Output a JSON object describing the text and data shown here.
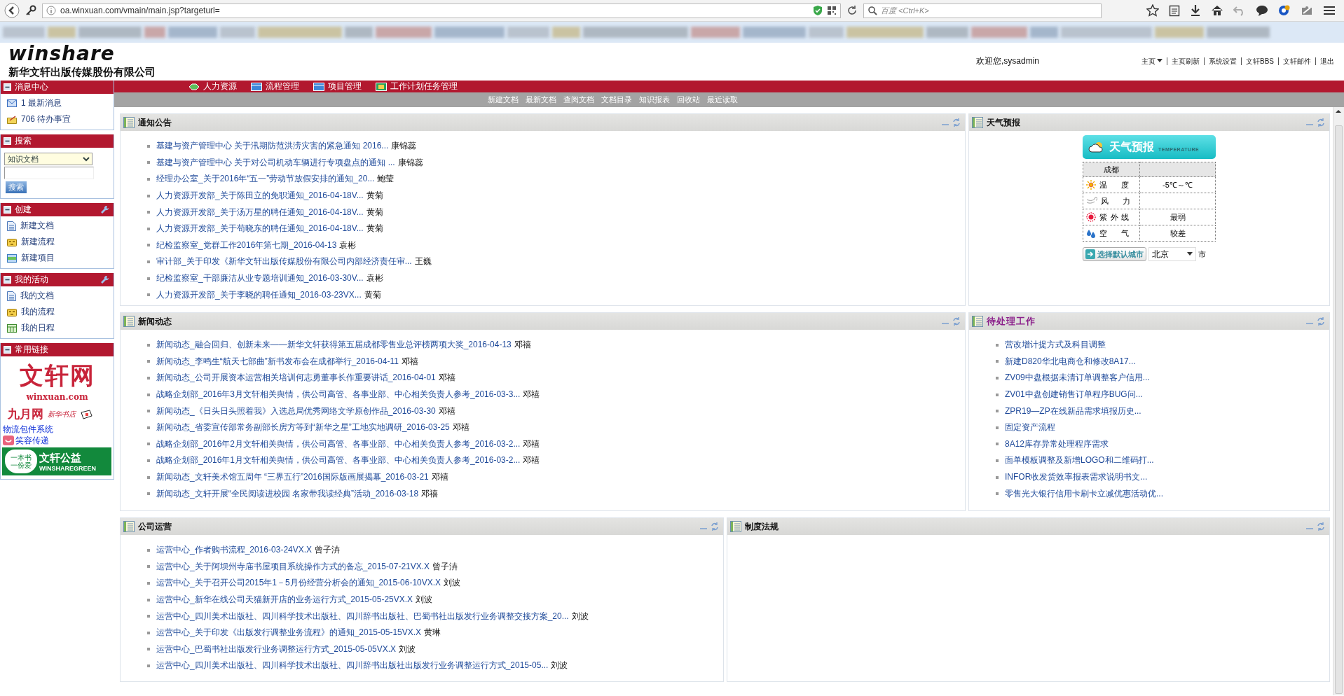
{
  "browser": {
    "url": "oa.winxuan.com/vmain/main.jsp?targeturl=",
    "search_placeholder": "百度 <Ctrl+K>"
  },
  "header": {
    "logo": "winshare",
    "company": "新华文轩出版传媒股份有限公司",
    "welcome": "欢迎您,sysadmin",
    "links": [
      "主页",
      "主页刷新",
      "系统设置",
      "文轩BBS",
      "文轩邮件",
      "退出"
    ]
  },
  "nav": {
    "tabs": [
      {
        "label": "人力资源",
        "selected": false
      },
      {
        "label": "流程管理",
        "selected": false
      },
      {
        "label": "项目管理",
        "selected": false
      },
      {
        "label": "工作计划任务管理",
        "selected": false
      }
    ],
    "subnav": [
      "新建文档",
      "最新文档",
      "查阅文档",
      "文档目录",
      "知识报表",
      "回收站",
      "最近读取"
    ]
  },
  "sidebar": [
    {
      "kind": "messages",
      "title": "消息中心",
      "tool": false,
      "items": [
        "1 最新消息",
        "706 待办事宜"
      ]
    },
    {
      "kind": "search",
      "title": "搜索",
      "tool": false,
      "select": "知识文档",
      "button": "搜索"
    },
    {
      "kind": "list",
      "title": "创建",
      "tool": true,
      "items": [
        "新建文档",
        "新建流程",
        "新建项目"
      ]
    },
    {
      "kind": "list",
      "title": "我的活动",
      "tool": true,
      "items": [
        "我的文档",
        "我的流程",
        "我的日程"
      ]
    },
    {
      "kind": "links",
      "title": "常用链接",
      "tool": false,
      "logo_1": {
        "name": "文轩网",
        "domain": "winxuan.com"
      },
      "logo_2": {
        "name": "九月网",
        "tag": "新华书店"
      },
      "links": [
        "物流包件系统",
        "笑容传递"
      ],
      "banner": {
        "slogan_1": "一本书",
        "slogan_2": "一份爱",
        "name": "文轩公益",
        "english": "WINSHAREGREEN"
      }
    }
  ],
  "rows": [
    [
      {
        "kind": "list",
        "title": "通知公告",
        "accent": false,
        "items": [
          {
            "title": "基建与资产管理中心 关于汛期防范洪涝灾害的紧急通知 2016...",
            "author": "康锦蕊"
          },
          {
            "title": "基建与资产管理中心 关于对公司机动车辆进行专项盘点的通知 ...",
            "author": "康锦蕊"
          },
          {
            "title": "经理办公室_关于2016年“五一”劳动节放假安排的通知_20...",
            "author": "鲍莹"
          },
          {
            "title": "人力资源开发部_关于陈田立的免职通知_2016-04-18V...",
            "author": "黄菊"
          },
          {
            "title": "人力资源开发部_关于汤万星的聘任通知_2016-04-18V...",
            "author": "黄菊"
          },
          {
            "title": "人力资源开发部_关于苟晓东的聘任通知_2016-04-18V...",
            "author": "黄菊"
          },
          {
            "title": "纪检监察室_党群工作2016年第七期_2016-04-13",
            "author": "袁彬"
          },
          {
            "title": "审计部_关于印发《新华文轩出版传媒股份有限公司内部经济责任审...",
            "author": "王巍"
          },
          {
            "title": "纪检监察室_干部廉洁从业专题培训通知_2016-03-30V...",
            "author": "袁彬"
          },
          {
            "title": "人力资源开发部_关于李晓的聘任通知_2016-03-23VX...",
            "author": "黄菊"
          }
        ]
      },
      {
        "kind": "weather",
        "title": "天气预报",
        "accent": false,
        "banner": "天气预报",
        "banner_sub": "TEMPERATURE",
        "city": "成都",
        "rows": [
          {
            "label": "温 度",
            "value": "-5℃～℃"
          },
          {
            "label": "风 力"
          },
          {
            "label": "紫外线",
            "value": "最弱"
          },
          {
            "label": "空 气",
            "value": "较差"
          }
        ],
        "button": "选择默认城市",
        "city_select": "北京",
        "suffix": "市"
      }
    ],
    [
      {
        "kind": "list",
        "title": "新闻动态",
        "accent": false,
        "items": [
          {
            "title": "新闻动态_融合回归、创新未来——新华文轩获得第五届成都零售业总评榜两项大奖_2016-04-13",
            "author": "邓禧"
          },
          {
            "title": "新闻动态_李鸣生“航天七部曲”新书发布会在成都举行_2016-04-11",
            "author": "邓禧"
          },
          {
            "title": "新闻动态_公司开展资本运营相关培训何志勇董事长作重要讲话_2016-04-01",
            "author": "邓禧"
          },
          {
            "title": "战略企划部_2016年3月文轩相关舆情，供公司高管、各事业部、中心相关负责人参考_2016-03-3...",
            "author": "邓禧"
          },
          {
            "title": "新闻动态_《日头日头照着我》入选总局优秀网络文学原创作品_2016-03-30",
            "author": "邓禧"
          },
          {
            "title": "新闻动态_省委宣传部常务副部长房方等到“新华之星”工地实地调研_2016-03-25",
            "author": "邓禧"
          },
          {
            "title": "战略企划部_2016年2月文轩相关舆情，供公司高管、各事业部、中心相关负责人参考_2016-03-2...",
            "author": "邓禧"
          },
          {
            "title": "战略企划部_2016年1月文轩相关舆情，供公司高管、各事业部、中心相关负责人参考_2016-03-2...",
            "author": "邓禧"
          },
          {
            "title": "新闻动态_文轩美术馆五周年 “三界五行”2016国际版画展揭幕_2016-03-21",
            "author": "邓禧"
          },
          {
            "title": "新闻动态_文轩开展“全民阅读进校园 名家带我读经典”活动_2016-03-18",
            "author": "邓禧"
          }
        ]
      },
      {
        "kind": "list",
        "title": "待处理工作",
        "accent": true,
        "items": [
          {
            "title": "营改增计提方式及科目调整"
          },
          {
            "title": "新建D820华北电商仓和修改8A17..."
          },
          {
            "title": "ZV09中盘根据未清订单调整客户信用..."
          },
          {
            "title": "ZV01中盘创建销售订单程序BUG问..."
          },
          {
            "title": "ZPR19—ZP在线新品需求填报历史..."
          },
          {
            "title": "固定资产流程"
          },
          {
            "title": "8A12库存异常处理程序需求"
          },
          {
            "title": "面单模板调整及新增LOGO和二维码打..."
          },
          {
            "title": "INFOR收发货效率报表需求说明书文..."
          },
          {
            "title": "零售光大银行信用卡刷卡立减优惠活动优..."
          }
        ]
      }
    ],
    [
      {
        "kind": "list",
        "title": "公司运营",
        "accent": false,
        "items": [
          {
            "title": "运营中心_作者购书流程_2016-03-24VX.X",
            "author": "曾子泋"
          },
          {
            "title": "运营中心_关于阿坝州寺庙书屋项目系统操作方式的备忘_2015-07-21VX.X",
            "author": "曾子泋"
          },
          {
            "title": "运营中心_关于召开公司2015年1－5月份经营分析会的通知_2015-06-10VX.X",
            "author": "刘波"
          },
          {
            "title": "运营中心_新华在线公司天猫新开店的业务运行方式_2015-05-25VX.X",
            "author": "刘波"
          },
          {
            "title": "运营中心_四川美术出版社、四川科学技术出版社、四川辞书出版社、巴蜀书社出版发行业务调整交接方案_20...",
            "author": "刘波"
          },
          {
            "title": "运营中心_关于印发《出版发行调整业务流程》的通知_2015-05-15VX.X",
            "author": "黄琳"
          },
          {
            "title": "运营中心_巴蜀书社出版发行业务调整运行方式_2015-05-05VX.X",
            "author": "刘波"
          },
          {
            "title": "运营中心_四川美术出版社、四川科学技术出版社、四川辞书出版社出版发行业务调整运行方式_2015-05...",
            "author": "刘波"
          }
        ]
      },
      {
        "kind": "list",
        "title": "制度法规",
        "accent": false
      }
    ]
  ]
}
